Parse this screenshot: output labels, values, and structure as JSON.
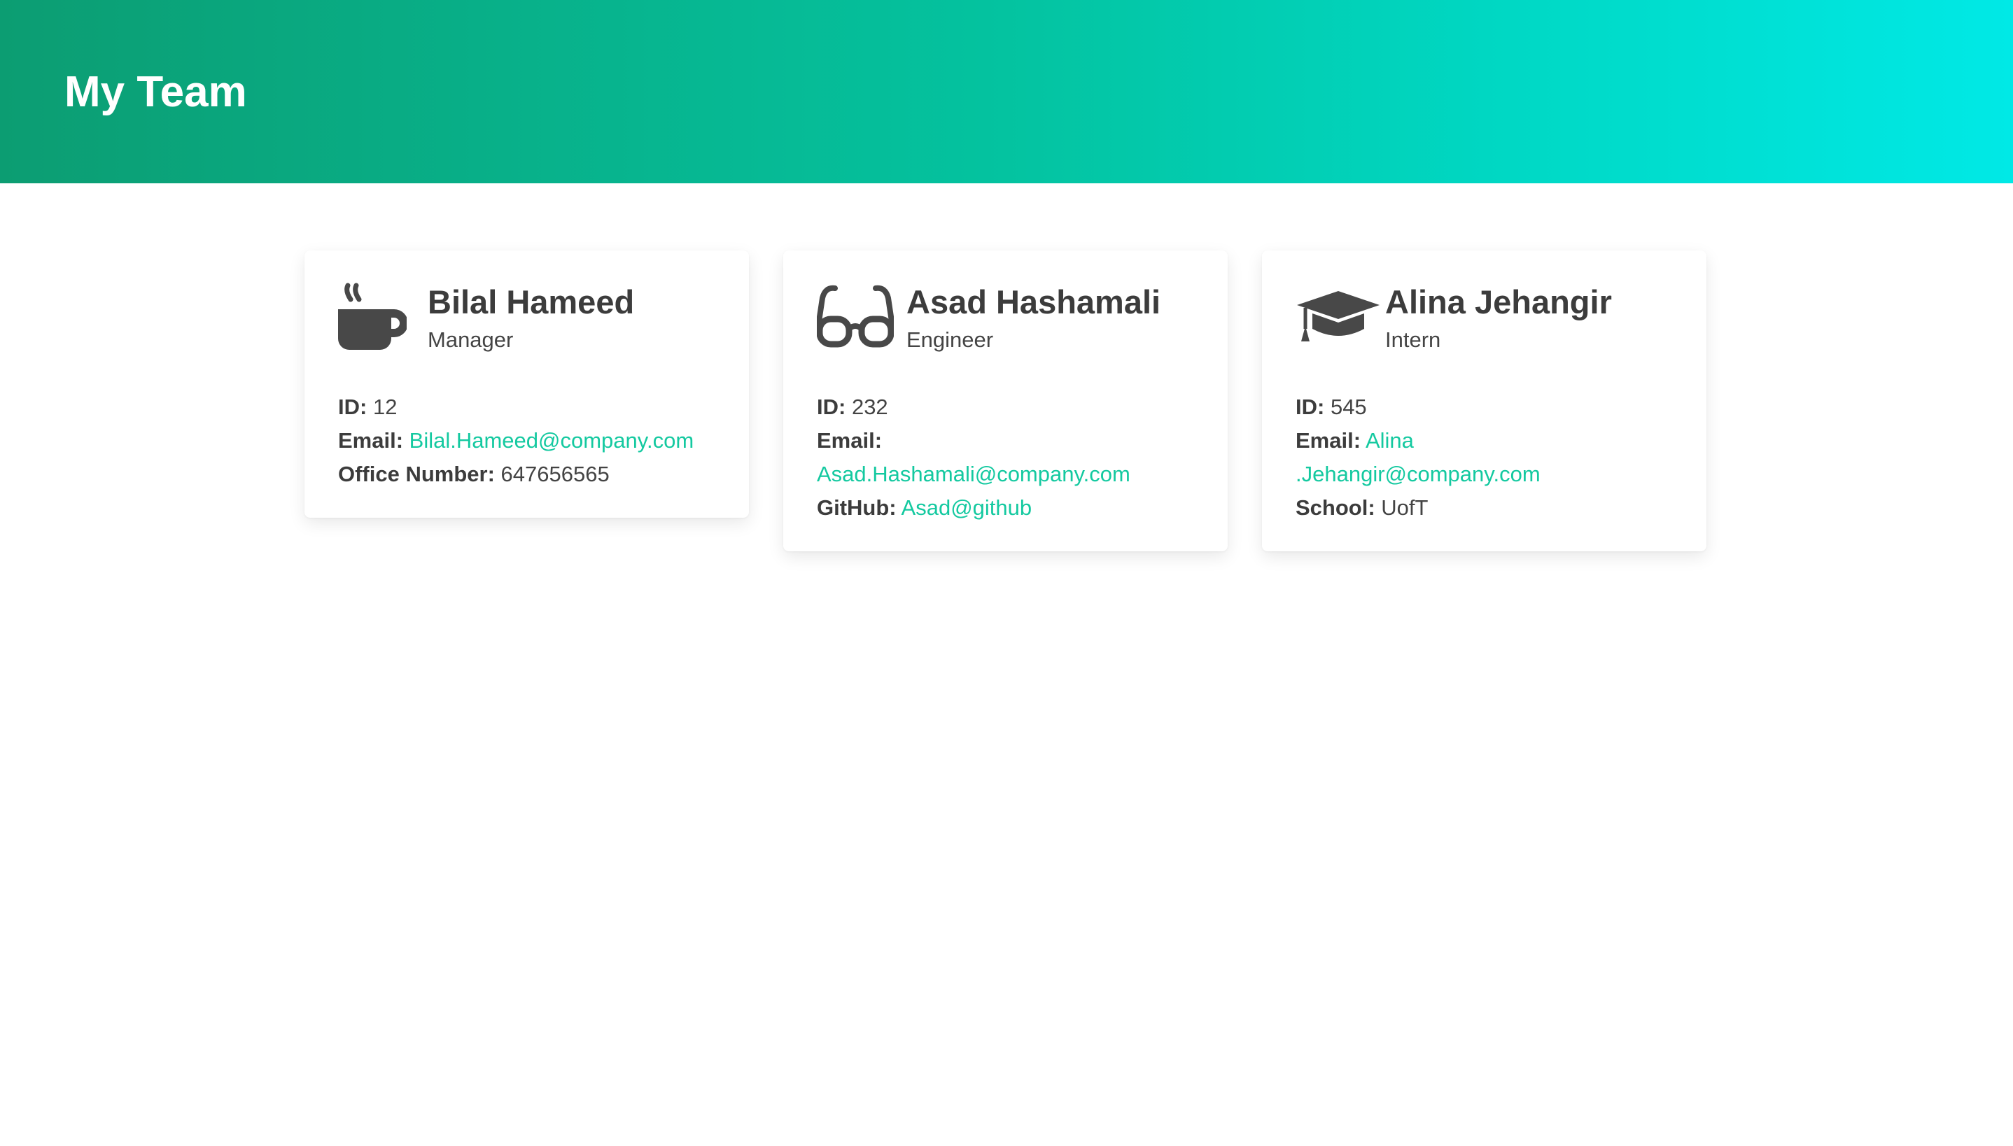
{
  "header": {
    "title": "My Team"
  },
  "colors": {
    "link": "#14c9a0",
    "gradient_start": "#0c9d72",
    "gradient_end": "#00e9e6"
  },
  "cards": [
    {
      "name": "Bilal Hameed",
      "role": "Manager",
      "icon": "coffee-mug-icon",
      "id_label": "ID:",
      "id": "12",
      "email_label": "Email:",
      "email": "Bilal.Hameed@company.com",
      "extra_label": "Office Number:",
      "extra": "647656565"
    },
    {
      "name": "Asad Hashamali",
      "role": "Engineer",
      "icon": "glasses-icon",
      "id_label": "ID:",
      "id": "232",
      "email_label": "Email:",
      "email": "Asad.Hashamali@company.com",
      "extra_label": "GitHub:",
      "extra": "Asad@github"
    },
    {
      "name": "Alina Jehangir",
      "role": "Intern",
      "icon": "graduation-cap-icon",
      "id_label": "ID:",
      "id": "545",
      "email_label": "Email:",
      "email": "Alina .Jehangir@company.com",
      "extra_label": "School:",
      "extra": "UofT"
    }
  ]
}
